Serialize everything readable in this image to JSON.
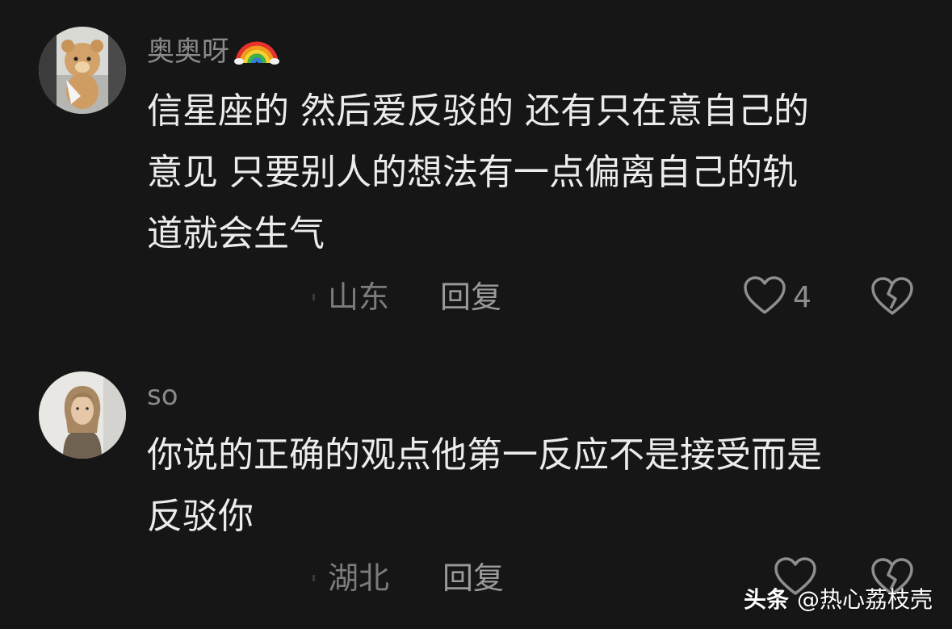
{
  "comments": [
    {
      "username": "奥奥呀",
      "emoji": "rainbow-icon",
      "text_lines": [
        "信星座的  然后爱反驳的 还有只在意自己的",
        "意见 只要别人的想法有一点偏离自己的轨",
        "道就会生气"
      ],
      "location": "山东",
      "reply_label": "回复",
      "likes": "4"
    },
    {
      "username": "so",
      "text_lines": [
        "你说的正确的观点他第一反应不是接受而是",
        "反驳你"
      ],
      "location": "湖北",
      "reply_label": "回复",
      "likes": ""
    }
  ],
  "watermark": {
    "brand": "头条",
    "handle": "@热心荔枝壳"
  },
  "colors": {
    "background": "#161616",
    "username": "#8a8a8a",
    "body": "#ececec",
    "icon": "#8e8e8e"
  }
}
